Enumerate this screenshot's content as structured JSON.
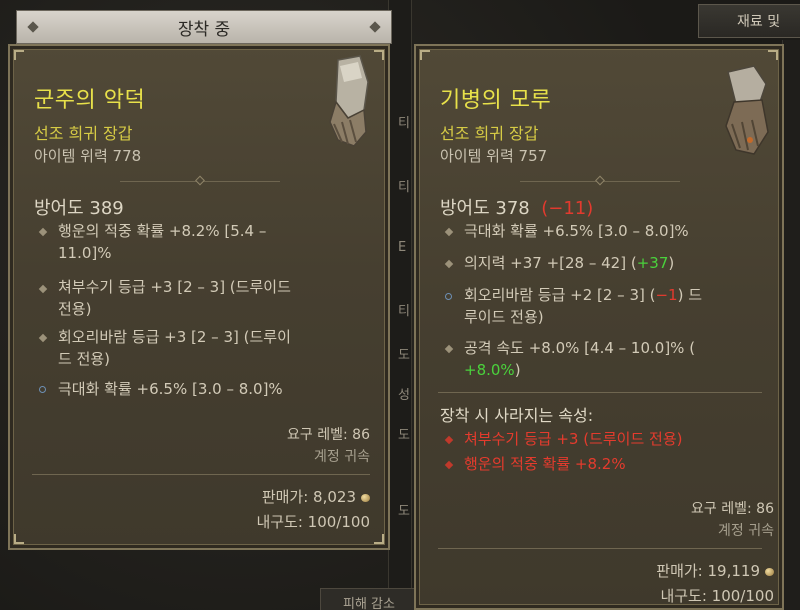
{
  "background": {
    "side_letters": [
      "티",
      "티",
      "Ε",
      "티",
      "도",
      "성",
      "도",
      "도"
    ],
    "right_button": "재료 및 ",
    "bottom_tab": "피해 감소"
  },
  "equipped": {
    "header": "장착 중",
    "name": "군주의 악덕",
    "type": "선조 희귀 장갑",
    "power": "아이템 위력 778",
    "armor": "방어도 389",
    "affixes": [
      {
        "line1": "행운의 적중 확률 +8.2% [5.4 –",
        "line2": "11.0]%"
      },
      {
        "line1": "쳐부수기 등급 +3 [2 – 3] (드루이드",
        "line2": "전용)"
      },
      {
        "line1": "회오리바람 등급 +3 [2 – 3] (드루이",
        "line2": "드 전용)"
      },
      {
        "line1": "극대화 확률 +6.5% [3.0 – 8.0]%"
      }
    ],
    "req_level": "요구 레벨: 86",
    "bind": "계정 귀속",
    "sell": "판매가: 8,023",
    "durability": "내구도: 100/100"
  },
  "compare": {
    "name": "기병의 모루",
    "type": "선조 희귀 장갑",
    "power": "아이템 위력 757",
    "armor": "방어도 378",
    "armor_diff": "(−11)",
    "affixes": [
      {
        "text": "극대화 확률 +6.5% [3.0 – 8.0]%"
      },
      {
        "text": "의지력 +37 +[28 – 42] (",
        "diff": "+37",
        "tail": ")"
      },
      {
        "text": "회오리바람 등급 +2 [2 – 3] (",
        "diff": "−1",
        "tail": ") 드",
        "line2": "루이드 전용)"
      },
      {
        "text": "공격 속도 +8.0% [4.4 – 10.0]% (",
        "line2_diff": "+8.0%",
        "line2_tail": ")"
      }
    ],
    "lost_header": "장착 시 사라지는 속성:",
    "lost_affixes": [
      "쳐부수기 등급 +3 (드루이드 전용)",
      "행운의 적중 확률 +8.2%"
    ],
    "req_level": "요구 레벨: 86",
    "bind": "계정 귀속",
    "sell": "판매가: 19,119",
    "durability": "내구도: 100/100"
  },
  "colors": {
    "item_name": "#e8e14a",
    "item_type": "#d6cb45",
    "negative": "#e23a2e",
    "positive": "#4ad23c"
  }
}
